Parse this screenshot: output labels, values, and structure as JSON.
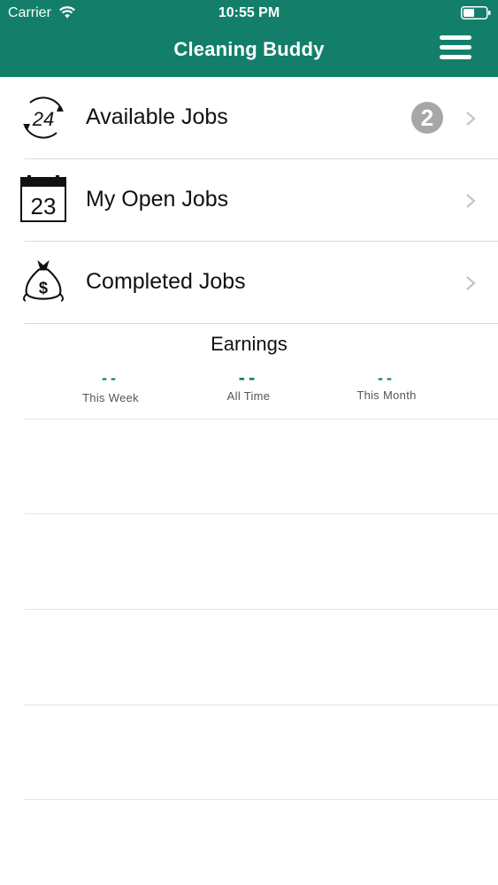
{
  "status_bar": {
    "carrier": "Carrier",
    "time": "10:55 PM",
    "wifi_icon": "wifi-icon",
    "battery_icon": "battery-icon"
  },
  "header": {
    "title": "Cleaning Buddy",
    "menu_icon": "hamburger-menu-icon",
    "background_color": "#137f6a"
  },
  "menu": {
    "items": [
      {
        "label": "Available Jobs",
        "icon": "24-hours-icon",
        "badge": "2"
      },
      {
        "label": "My Open Jobs",
        "icon": "calendar-icon",
        "calendar_day": "23"
      },
      {
        "label": "Completed Jobs",
        "icon": "money-bag-icon"
      }
    ]
  },
  "earnings": {
    "title": "Earnings",
    "stats": [
      {
        "value": "--",
        "caption": "This Week"
      },
      {
        "value": "--",
        "caption": "All Time"
      },
      {
        "value": "--",
        "caption": "This Month"
      }
    ]
  },
  "colors": {
    "accent": "#137f6a",
    "badge": "#a7a7a7"
  }
}
